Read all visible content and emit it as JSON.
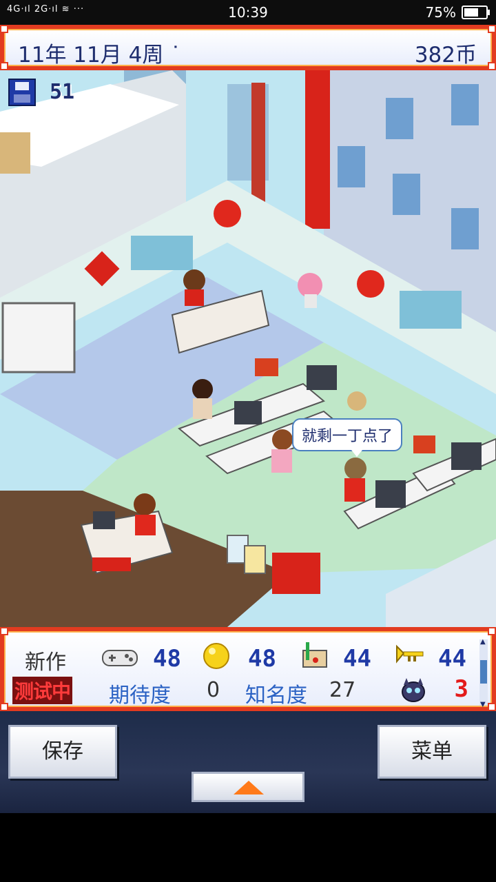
{
  "status_bar": {
    "signal_text": "4G⋅ıl 2G⋅ıl ≋ ···",
    "time": "10:39",
    "battery": "75%",
    "battery_level": 0.75
  },
  "top_bar": {
    "date": "11年 11月 4周 ˙",
    "coins": "382币"
  },
  "scene": {
    "save_count": "51",
    "speech_bubble": "就剩一丁点了"
  },
  "panel": {
    "title": "新作",
    "status": "测试中",
    "stats": [
      {
        "icon": "controller-icon",
        "value": "48"
      },
      {
        "icon": "gold-orb-icon",
        "value": "48"
      },
      {
        "icon": "paint-icon",
        "value": "44"
      },
      {
        "icon": "trumpet-icon",
        "value": "44"
      }
    ],
    "expectation_label": "期待度",
    "expectation_value": "0",
    "fame_label": "知名度",
    "fame_value": "27",
    "fan_icon": "monster-icon",
    "fan_value": "3"
  },
  "buttons": {
    "save": "保存",
    "menu": "菜单",
    "up_icon": "triangle-up-icon"
  },
  "colors": {
    "frame_red": "#e23b20",
    "text_navy": "#1e2d6e",
    "accent_blue": "#2b62c4",
    "alert_red": "#e31b1b"
  }
}
